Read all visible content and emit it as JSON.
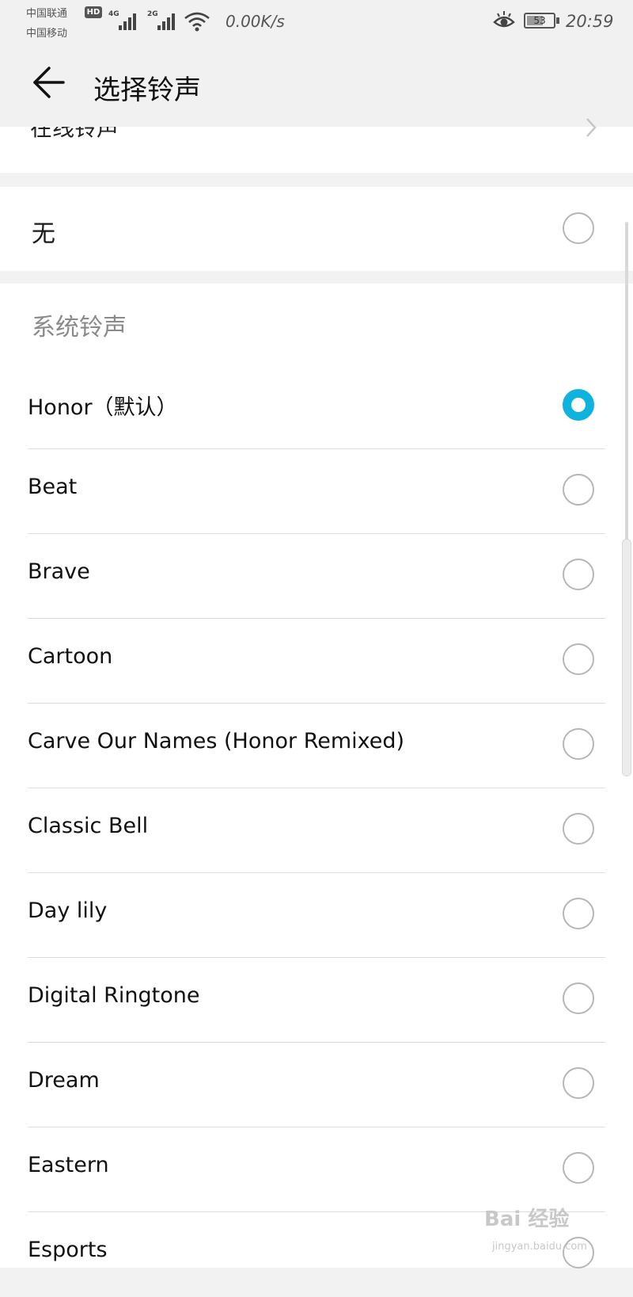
{
  "status_bar": {
    "carrier_1": "中国联通",
    "hd_badge": "HD",
    "carrier_2": "中国移动",
    "net_1": "4G",
    "net_2": "2G",
    "speed": "0.00K/s",
    "battery": "53",
    "time": "20:59",
    "icons": [
      "signal-icon",
      "wifi-icon",
      "eye-comfort-icon",
      "battery-icon"
    ]
  },
  "header": {
    "title": "选择铃声",
    "back_icon": "back-arrow-icon"
  },
  "online": {
    "label": "在线铃声",
    "icon": "chevron-right-icon"
  },
  "none_option": {
    "label": "无",
    "selected": false
  },
  "system": {
    "section_title": "系统铃声",
    "items": [
      {
        "label": "Honor（默认）",
        "selected": true
      },
      {
        "label": "Beat",
        "selected": false
      },
      {
        "label": "Brave",
        "selected": false
      },
      {
        "label": "Cartoon",
        "selected": false
      },
      {
        "label": "Carve Our Names (Honor Remixed)",
        "selected": false
      },
      {
        "label": "Classic Bell",
        "selected": false
      },
      {
        "label": "Day lily",
        "selected": false
      },
      {
        "label": "Digital Ringtone",
        "selected": false
      },
      {
        "label": "Dream",
        "selected": false
      },
      {
        "label": "Eastern",
        "selected": false
      },
      {
        "label": "Esports",
        "selected": false
      }
    ]
  },
  "watermark": {
    "text": "Bai 经验",
    "url": "jingyan.baidu.com"
  },
  "colors": {
    "accent": "#0FB3DE",
    "background": "#F2F2F2",
    "card": "#FFFFFF"
  }
}
